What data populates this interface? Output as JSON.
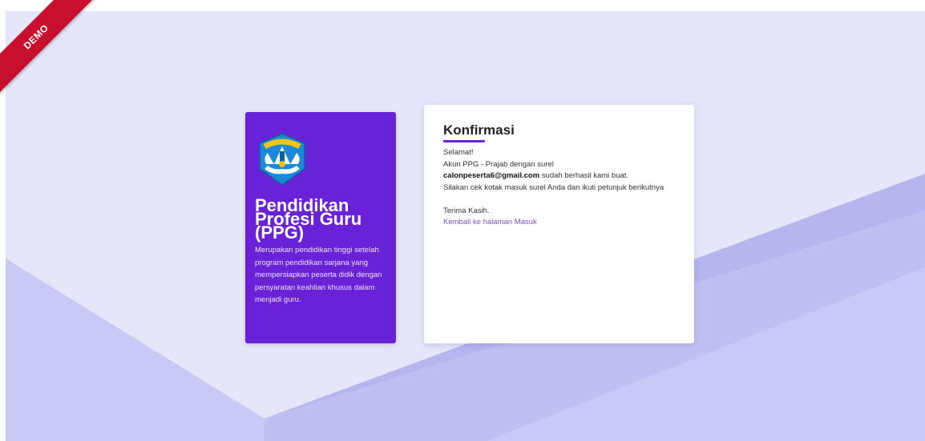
{
  "ribbon": {
    "label": "DEMO",
    "color": "#c8102e"
  },
  "intro_card": {
    "logo_icon": "tut-wuri-handayani-emblem",
    "logo_text": "TUT WURI HANDAYANI",
    "title_line1": "Pendidikan",
    "title_line2": "Profesi Guru",
    "title_line3": "(PPG)",
    "description": "Merupakan pendidikan tinggi setelah program pendidikan sarjana yang mempersiapkan peserta didik dengan persyaratan keahlian khusus dalam menjadi guru.",
    "background_color": "#6a22d8"
  },
  "confirm_card": {
    "heading": "Konfirmasi",
    "greeting": "Selamat!",
    "line_account": "Akun PPG - Prajab dengan surel",
    "email": "calonpeserta6@gmail.com",
    "line_created": " sudah berhasil kami buat.",
    "line_instructions": "Silakan cek kotak masuk surel Anda dan ikuti petunjuk berikutnya",
    "thanks": "Terima Kasih.",
    "back_link": "Kembali ke halaman Masuk",
    "accent_color": "#6a22d8"
  }
}
